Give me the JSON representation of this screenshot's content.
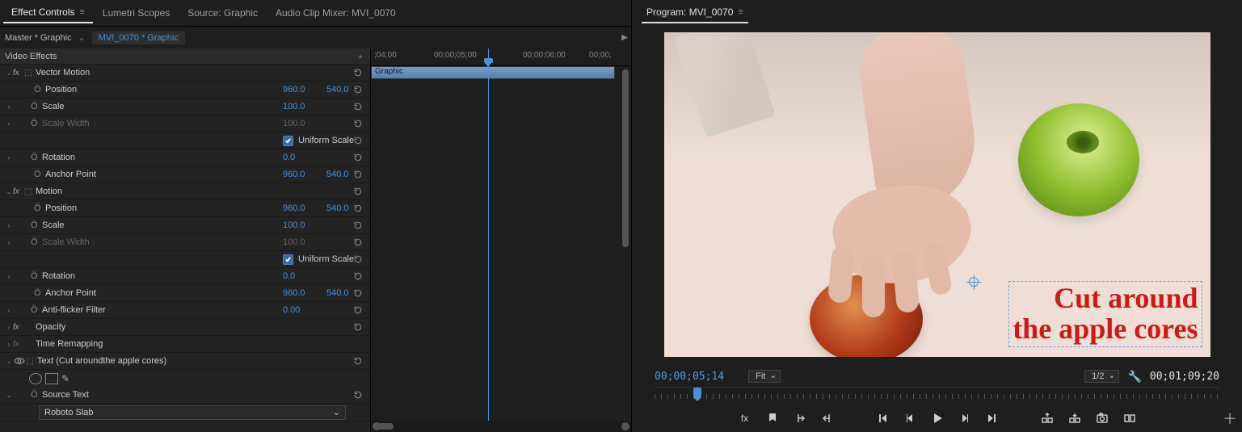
{
  "tabs": {
    "effect_controls": "Effect Controls",
    "lumetri_scopes": "Lumetri Scopes",
    "source": "Source: Graphic",
    "audio_mixer": "Audio Clip Mixer: MVI_0070"
  },
  "master_bar": {
    "master": "Master * Graphic",
    "clip": "MVI_0070 * Graphic"
  },
  "timeline": {
    "ticks": [
      ";04;00",
      "00;00;05;00",
      "00;00;06;00",
      "00;00;"
    ],
    "clip_label": "Graphic"
  },
  "sections": {
    "video_effects": "Video Effects"
  },
  "effects": {
    "vector_motion": {
      "name": "Vector Motion",
      "position": {
        "label": "Position",
        "x": "960.0",
        "y": "540.0"
      },
      "scale": {
        "label": "Scale",
        "v": "100.0"
      },
      "scale_width": {
        "label": "Scale Width",
        "v": "100.0"
      },
      "uniform": "Uniform Scale",
      "rotation": {
        "label": "Rotation",
        "v": "0.0"
      },
      "anchor": {
        "label": "Anchor Point",
        "x": "960.0",
        "y": "540.0"
      }
    },
    "motion": {
      "name": "Motion",
      "position": {
        "label": "Position",
        "x": "960.0",
        "y": "540.0"
      },
      "scale": {
        "label": "Scale",
        "v": "100.0"
      },
      "scale_width": {
        "label": "Scale Width",
        "v": "100.0"
      },
      "uniform": "Uniform Scale",
      "rotation": {
        "label": "Rotation",
        "v": "0.0"
      },
      "anchor": {
        "label": "Anchor Point",
        "x": "960.0",
        "y": "540.0"
      },
      "antiflicker": {
        "label": "Anti-flicker Filter",
        "v": "0.00"
      }
    },
    "opacity": {
      "name": "Opacity"
    },
    "time_remap": {
      "name": "Time Remapping"
    },
    "text_layer": {
      "name": "Text (Cut aroundthe apple cores)",
      "source_text": "Source Text",
      "font": "Roboto Slab"
    }
  },
  "program": {
    "tab": "Program: MVI_0070",
    "overlay_text": "Cut around\nthe apple cores",
    "current_tc": "00;00;05;14",
    "fit": "Fit",
    "scale": "1/2",
    "duration_tc": "00;01;09;20"
  }
}
